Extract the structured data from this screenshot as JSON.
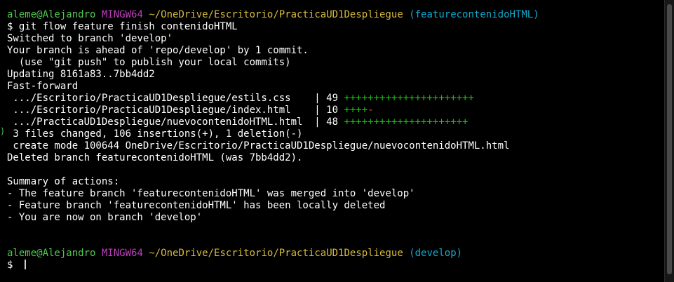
{
  "prompt1": {
    "user_host": "aleme@Alejandro",
    "system": "MINGW64",
    "path": "~/OneDrive/Escritorio/PracticaUD1Despliegue",
    "branch": "(featurecontenidoHTML)"
  },
  "command1": "$ git flow feature finish contenidoHTML",
  "output": [
    "Switched to branch 'develop'",
    "Your branch is ahead of 'repo/develop' by 1 commit.",
    "  (use \"git push\" to publish your local commits)",
    "Updating 8161a83..7bb4dd2",
    "Fast-forward"
  ],
  "diffstat": [
    {
      "file": " .../Escritorio/PracticaUD1Despliegue/estils.css    ",
      "sep": "| 49 ",
      "plus": "++++++++++++++++++++++",
      "minus": ""
    },
    {
      "file": " .../Escritorio/PracticaUD1Despliegue/index.html    ",
      "sep": "| 10 ",
      "plus": "++++",
      "minus": "-"
    },
    {
      "file": " .../PracticaUD1Despliegue/nuevocontenidoHTML.html  ",
      "sep": "| 48 ",
      "plus": "+++++++++++++++++++++",
      "minus": ""
    }
  ],
  "summary_lines": [
    " 3 files changed, 106 insertions(+), 1 deletion(-)",
    " create mode 100644 OneDrive/Escritorio/PracticaUD1Despliegue/nuevocontenidoHTML.html",
    "Deleted branch featurecontenidoHTML (was 7bb4dd2).",
    "",
    "Summary of actions:",
    "- The feature branch 'featurecontenidoHTML' was merged into 'develop'",
    "- Feature branch 'featurecontenidoHTML' has been locally deleted",
    "- You are now on branch 'develop'"
  ],
  "prompt2": {
    "user_host": "aleme@Alejandro",
    "system": "MINGW64",
    "path": "~/OneDrive/Escritorio/PracticaUD1Despliegue",
    "branch": "(develop)"
  },
  "command2": "$ ",
  "gutter_marker": ")",
  "colors": {
    "background": "#000000",
    "user": "#4ec94e",
    "system": "#bc3fbc",
    "path": "#d7ba3d",
    "branch": "#11a8cd",
    "plus": "#16c60c",
    "minus": "#e74856"
  }
}
